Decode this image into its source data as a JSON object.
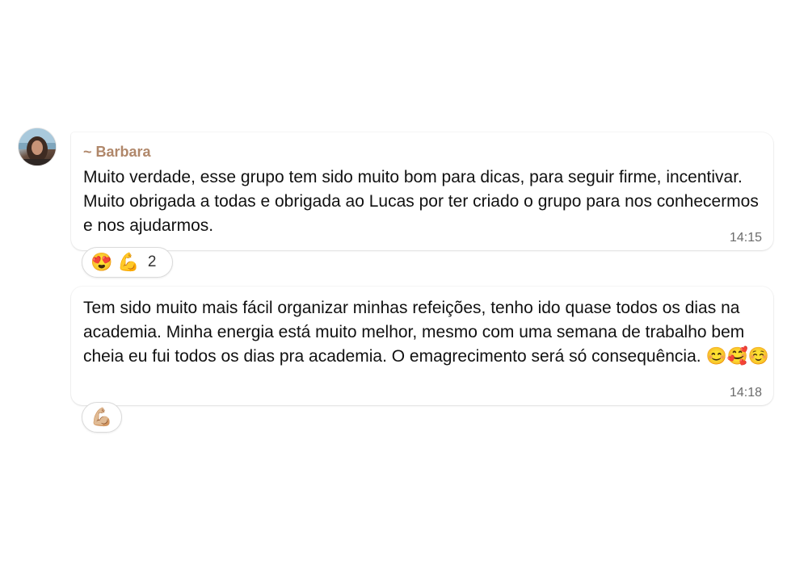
{
  "messages": [
    {
      "sender": "~ Barbara",
      "text": "Muito verdade, esse grupo tem sido muito bom para dicas, para seguir firme, incentivar. Muito obrigada a todas e obrigada ao Lucas por ter criado o grupo para nos conhecermos e nos ajudarmos.",
      "time": "14:15",
      "reactions": [
        "😍",
        "💪"
      ],
      "reaction_count": "2"
    },
    {
      "text": "Tem sido muito mais fácil organizar minhas refeições, tenho ido quase todos os dias na academia. Minha energia está muito melhor, mesmo com uma semana de trabalho bem  cheia eu fui todos os dias pra academia. O emagrecimento será só consequência. 😊🥰☺️",
      "time": "14:18",
      "reactions": [
        "💪🏼"
      ]
    }
  ],
  "colors": {
    "sender_name": "#b0876a",
    "timestamp": "#6b6b6b",
    "bubble": "#ffffff"
  },
  "icons": {
    "avatar": "profile-photo"
  }
}
